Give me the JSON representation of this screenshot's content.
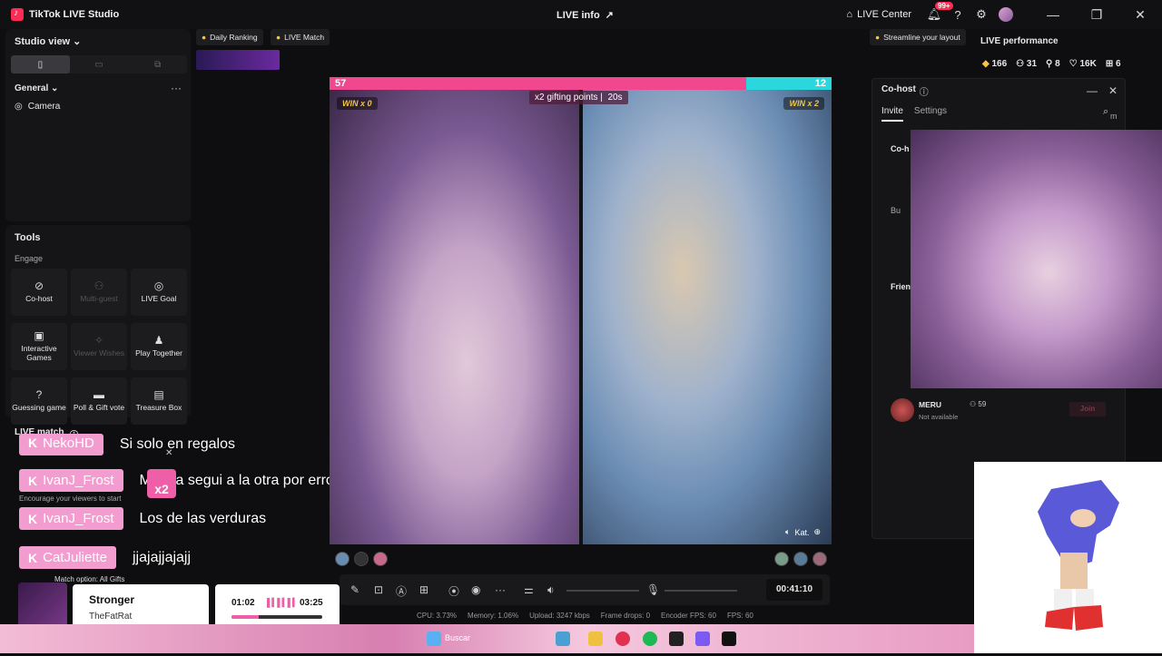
{
  "titlebar": {
    "app_title": "TikTok LIVE Studio",
    "live_info": "LIVE info",
    "live_center": "LIVE Center",
    "notif_badge": "99+"
  },
  "studio": {
    "title": "Studio view",
    "general": "General",
    "camera": "Camera"
  },
  "tools": {
    "title": "Tools",
    "engage": "Engage",
    "items": [
      {
        "label": "Co-host",
        "icon": "link-icon",
        "enabled": true
      },
      {
        "label": "Multi-guest",
        "icon": "people-icon",
        "enabled": false
      },
      {
        "label": "LIVE Goal",
        "icon": "target-icon",
        "enabled": true
      },
      {
        "label": "Interactive Games",
        "icon": "gamepad-icon",
        "enabled": true
      },
      {
        "label": "Viewer Wishes",
        "icon": "wish-icon",
        "enabled": false
      },
      {
        "label": "Play Together",
        "icon": "person-icon",
        "enabled": true
      },
      {
        "label": "Guessing game",
        "icon": "question-icon",
        "enabled": true
      },
      {
        "label": "Poll & Gift vote",
        "icon": "poll-icon",
        "enabled": true
      },
      {
        "label": "Treasure Box",
        "icon": "box-icon",
        "enabled": true
      }
    ]
  },
  "live_match": {
    "title": "LIVE match",
    "encourage": "Encourage your viewers to start",
    "match_option": "Match option: All Gifts"
  },
  "chat": [
    {
      "user": "NekoHD",
      "message": "Si solo en regalos"
    },
    {
      "user": "IvanJ_Frost",
      "message": "Mierda segui a la otra por error"
    },
    {
      "user": "IvanJ_Frost",
      "message": "Los de las verduras"
    },
    {
      "user": "CatJuliette",
      "message": "jjajajjajajj"
    }
  ],
  "x2_label": "x2",
  "music": {
    "song": "Stronger",
    "artist": "TheFatRat",
    "elapsed": "01:02",
    "total": "03:25",
    "progress": 0.3
  },
  "chips": {
    "daily_ranking": "Daily Ranking",
    "live_match": "LIVE Match",
    "streamline": "Streamline your layout"
  },
  "battle": {
    "score_left": "57",
    "score_right": "12",
    "left_share": 0.83,
    "win_left": "WIN x 0",
    "win_right": "WIN x 2",
    "gifting": "x2 gifting points",
    "countdown": "20s",
    "opponent": "Kat."
  },
  "controls": {
    "timer": "00:41:10"
  },
  "stats": {
    "cpu": "CPU: 3.73%",
    "memory": "Memory: 1.06%",
    "upload": "Upload: 3247 kbps",
    "frame_drops": "Frame drops: 0",
    "encoder_fps": "Encoder FPS: 60",
    "fps": "FPS: 60"
  },
  "performance": {
    "title": "LIVE performance",
    "values": [
      {
        "icon": "diamond-icon",
        "value": "166"
      },
      {
        "icon": "viewers-icon",
        "value": "31"
      },
      {
        "icon": "follow-icon",
        "value": "8"
      },
      {
        "icon": "heart-icon",
        "value": "16K"
      },
      {
        "icon": "gift-icon",
        "value": "6"
      }
    ]
  },
  "cohost": {
    "title": "Co-host",
    "tab_invite": "Invite",
    "tab_settings": "Settings",
    "section_cohost": "Co-h",
    "section_friends": "Frien",
    "section_bu": "Bu",
    "partial_m": "m",
    "friend": {
      "name": "MERU",
      "count": "59",
      "status": "Not available",
      "action": "Join"
    }
  },
  "taskbar": {
    "search": "Buscar"
  }
}
